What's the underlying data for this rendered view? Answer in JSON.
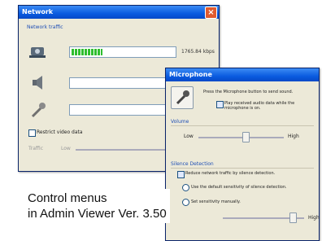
{
  "network_window": {
    "title": "Network",
    "section_label": "Network traffic",
    "rate": "1765.84 kbps",
    "video_level": 0.3,
    "checkbox_label": "Restrict video data",
    "traffic_label": "Traffic",
    "traffic_low": "Low",
    "icons": [
      "camera-icon",
      "speaker-icon",
      "microphone-icon"
    ]
  },
  "microphone_window": {
    "title": "Microphone",
    "instruction": "Press the Microphone button to send sound.",
    "play_option": "Play received audio data while the microphone is on.",
    "volume_group": "Volume",
    "volume_low": "Low",
    "volume_high": "High",
    "silence_group": "Silence Detection",
    "reduce_option": "Reduce network traffic by silence detection.",
    "default_option": "Use the default sensitivity of silence detection.",
    "manual_option": "Set sensitivity manually.",
    "manual_high": "High"
  },
  "caption": {
    "line1": "Control menus",
    "line2": "in Admin Viewer Ver. 3.50"
  }
}
